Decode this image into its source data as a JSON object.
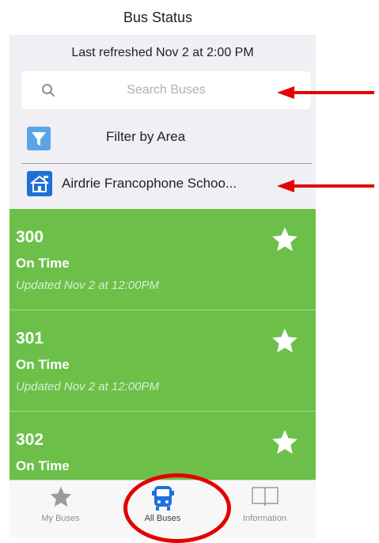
{
  "header": {
    "title": "Bus Status"
  },
  "refresh": {
    "text": "Last refreshed Nov 2 at 2:00 PM"
  },
  "search": {
    "placeholder": "Search Buses"
  },
  "filter": {
    "label": "Filter by Area"
  },
  "school": {
    "label": "Airdrie Francophone Schoo..."
  },
  "buses": [
    {
      "number": "300",
      "status": "On Time",
      "updated": "Updated Nov 2 at 12:00PM"
    },
    {
      "number": "301",
      "status": "On Time",
      "updated": "Updated Nov 2 at 12:00PM"
    },
    {
      "number": "302",
      "status": "On Time",
      "updated": ""
    }
  ],
  "tabs": [
    {
      "label": "My Buses",
      "icon": "star-icon"
    },
    {
      "label": "All Buses",
      "icon": "bus-icon"
    },
    {
      "label": "Information",
      "icon": "book-icon"
    }
  ],
  "colors": {
    "card_green": "#6cc04a",
    "filter_blue": "#5aa5e8",
    "school_blue": "#1f6fd6",
    "active_tab_blue": "#1e6fe0",
    "annotation_red": "#e40000"
  }
}
